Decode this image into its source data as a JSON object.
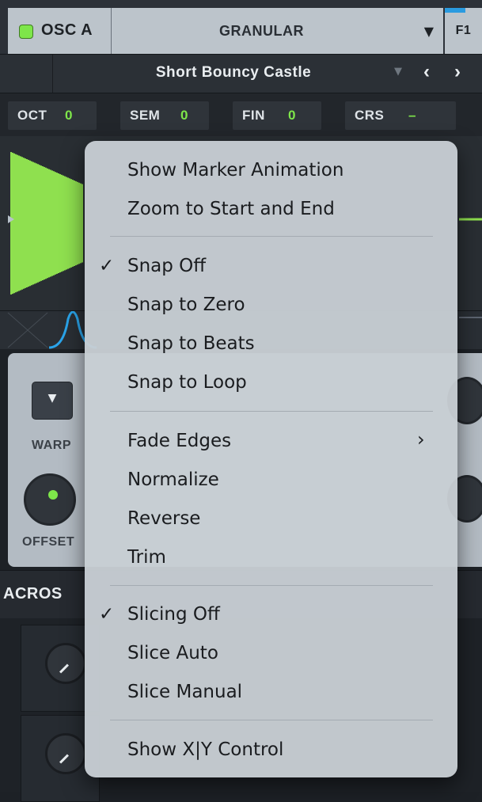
{
  "oscillator": {
    "name": "OSC A",
    "enabled": true,
    "mode": "GRANULAR",
    "mode_arrow": "▼",
    "filter_label": "F1",
    "accent_color": "#7ee64a"
  },
  "preset": {
    "name": "Short Bouncy Castle",
    "menu_arrow": "▼",
    "prev": "‹",
    "next": "›"
  },
  "tuning": [
    {
      "label": "OCT",
      "value": "0"
    },
    {
      "label": "SEM",
      "value": "0"
    },
    {
      "label": "FIN",
      "value": "0"
    },
    {
      "label": "CRS",
      "value": "–"
    }
  ],
  "panel": {
    "warp_label": "WARP",
    "warp_arrow": "▼",
    "offset_label": "OFFSET"
  },
  "macros": {
    "label": "ACROS"
  },
  "context_menu": {
    "items": [
      {
        "label": "Show Marker Animation",
        "checked": false,
        "submenu": false
      },
      {
        "label": "Zoom to Start and End",
        "checked": false,
        "submenu": false
      },
      {
        "label": "Snap Off",
        "checked": true,
        "submenu": false
      },
      {
        "label": "Snap to Zero",
        "checked": false,
        "submenu": false
      },
      {
        "label": "Snap to Beats",
        "checked": false,
        "submenu": false
      },
      {
        "label": "Snap to Loop",
        "checked": false,
        "submenu": false
      },
      {
        "label": "Fade Edges",
        "checked": false,
        "submenu": true
      },
      {
        "label": "Normalize",
        "checked": false,
        "submenu": false
      },
      {
        "label": "Reverse",
        "checked": false,
        "submenu": false
      },
      {
        "label": "Trim",
        "checked": false,
        "submenu": false
      },
      {
        "label": "Slicing Off",
        "checked": true,
        "submenu": false
      },
      {
        "label": "Slice Auto",
        "checked": false,
        "submenu": false
      },
      {
        "label": "Slice Manual",
        "checked": false,
        "submenu": false
      },
      {
        "label": "Show X|Y Control",
        "checked": false,
        "submenu": false
      }
    ],
    "check_glyph": "✓",
    "submenu_glyph": "›"
  }
}
